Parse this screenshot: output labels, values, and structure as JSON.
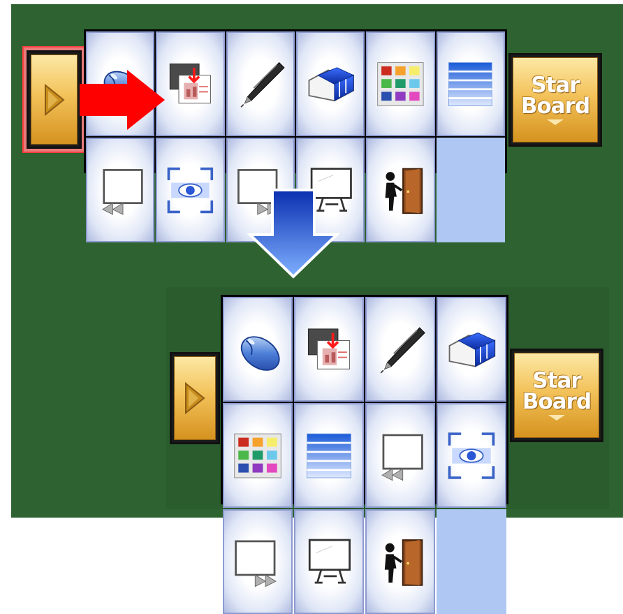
{
  "starboard_button": {
    "line1": "Star",
    "line2": "Board"
  },
  "toolbar_before": {
    "tools": [
      "mouse",
      "capture",
      "pen",
      "eraser",
      "palette",
      "screen-shade",
      "previous-page",
      "spotlight",
      "next-page",
      "whiteboard",
      "exit",
      "empty"
    ]
  },
  "toolbar_after": {
    "tools": [
      "mouse",
      "capture",
      "pen",
      "eraser",
      "palette",
      "screen-shade",
      "previous-page",
      "spotlight",
      "next-page",
      "whiteboard",
      "exit",
      "empty"
    ]
  },
  "colors": {
    "background": "#2e6230",
    "accent_red": "#ff0000",
    "accent_blue": "#2a5fe0"
  },
  "icons": [
    "play-icon",
    "mouse-icon",
    "capture-icon",
    "pen-icon",
    "eraser-icon",
    "palette-icon",
    "screen-shade-icon",
    "previous-page-icon",
    "spotlight-icon",
    "next-page-icon",
    "whiteboard-icon",
    "exit-door-icon",
    "red-arrow-right-icon",
    "blue-arrow-down-icon"
  ]
}
